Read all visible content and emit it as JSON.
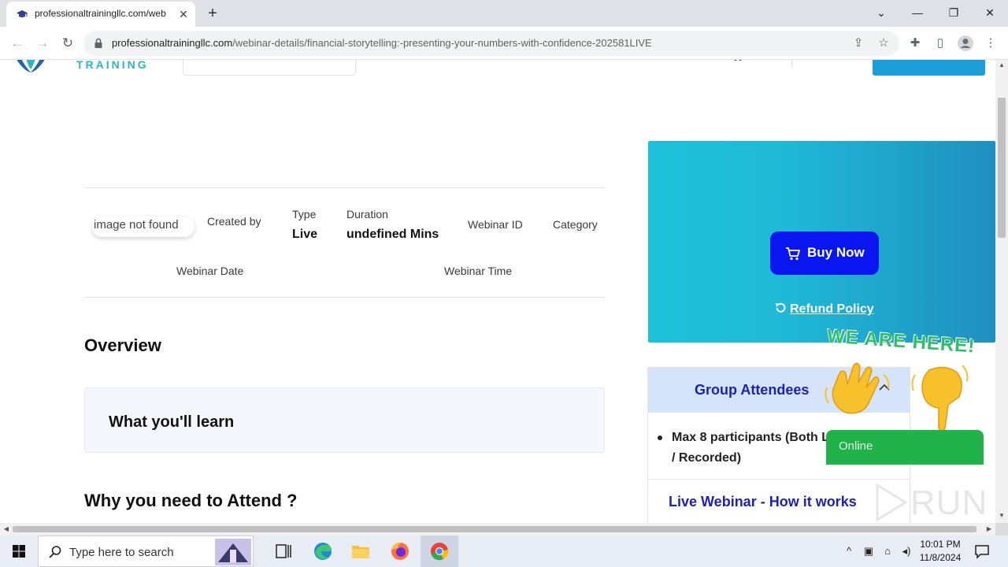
{
  "browser": {
    "tab_title": "professionaltrainingllc.com/web",
    "tab_close": "✕",
    "new_tab": "+",
    "url_host": "professionaltrainingllc.com",
    "url_path": "/webinar-details/financial-storytelling:-presenting-your-numbers-with-confidence-202581LIVE",
    "window_controls": [
      "⌄",
      "—",
      "❐",
      "✕"
    ]
  },
  "site": {
    "logo_text": "TRAINING"
  },
  "meta": {
    "image_alt": "image not found",
    "created_by_label": "Created by",
    "type_label": "Type",
    "type_value": "Live",
    "duration_label": "Duration",
    "duration_value": "undefined Mins",
    "webinar_id_label": "Webinar ID",
    "category_label": "Category",
    "webinar_date_label": "Webinar Date",
    "webinar_time_label": "Webinar Time"
  },
  "content": {
    "overview_heading": "Overview",
    "learn_heading": "What you'll learn",
    "why_heading": "Why you need to Attend ?"
  },
  "purchase": {
    "buy_label": "Buy Now",
    "refund_label": "Refund Policy"
  },
  "group": {
    "title": "Group Attendees",
    "item": "Max 8 participants (Both Live / Recorded)",
    "live_how": "Live Webinar - How it works"
  },
  "widget": {
    "headline": "WE ARE HERE!",
    "status": "Online",
    "watermark": "RUN"
  },
  "taskbar": {
    "search_placeholder": "Type here to search",
    "time": "10:01 PM",
    "date": "11/8/2024"
  },
  "colors": {
    "accent": "#1c9fd8",
    "buy_button": "#0a16f0",
    "group_title": "#1f1fb8",
    "widget_green": "#21b24a"
  }
}
